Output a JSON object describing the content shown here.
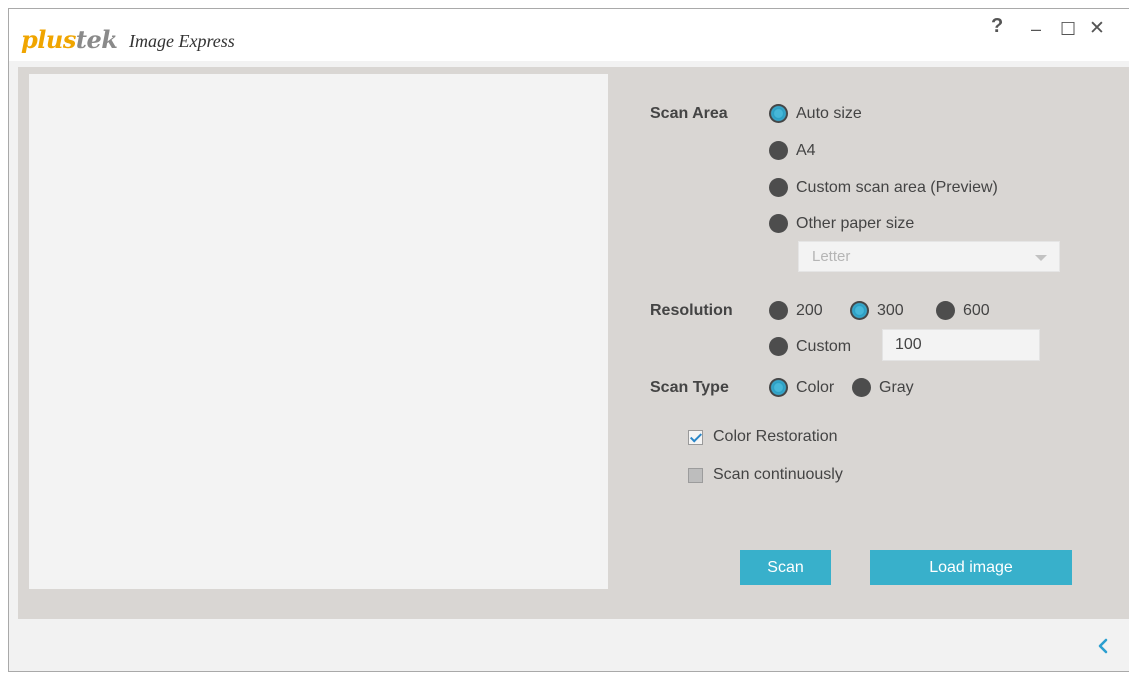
{
  "app": {
    "brand_plus": "plus",
    "brand_tek": "tek",
    "title": "Image Express"
  },
  "window_controls": {
    "help": "?",
    "minimize": "–",
    "maximize": "☐",
    "close": "✕"
  },
  "scan_area": {
    "label": "Scan Area",
    "options": [
      "Auto size",
      "A4",
      "Custom scan area (Preview)",
      "Other paper size"
    ],
    "selected": "Auto size",
    "paper_size_value": "Letter"
  },
  "resolution": {
    "label": "Resolution",
    "options": [
      "200",
      "300",
      "600",
      "Custom"
    ],
    "selected": "300",
    "custom_value": "100"
  },
  "scan_type": {
    "label": "Scan Type",
    "options": [
      "Color",
      "Gray"
    ],
    "selected": "Color"
  },
  "checkboxes": {
    "color_restoration": {
      "label": "Color Restoration",
      "checked": true
    },
    "scan_continuously": {
      "label": "Scan continuously",
      "checked": false
    }
  },
  "buttons": {
    "scan": "Scan",
    "load_image": "Load image"
  },
  "colors": {
    "accent": "#38b0cb",
    "brand": "#f0a500",
    "panel": "#d9d6d3"
  },
  "icons": {
    "collapse": "chevron-left-icon"
  }
}
